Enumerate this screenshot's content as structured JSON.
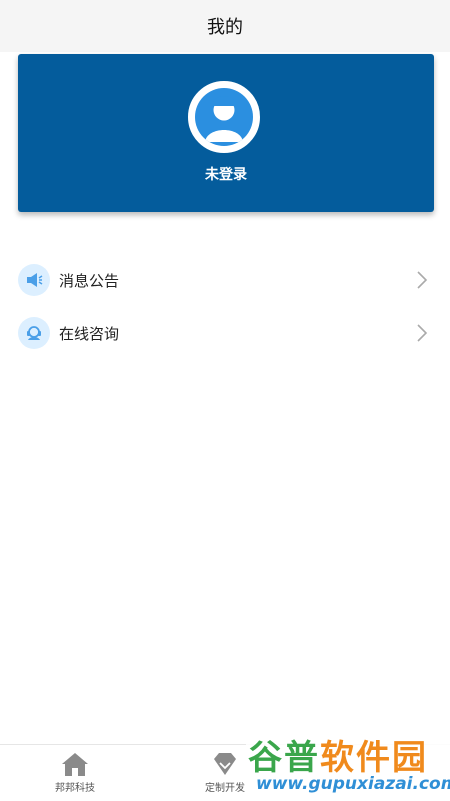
{
  "header": {
    "title": "我的"
  },
  "profile": {
    "login_status": "未登录"
  },
  "menu": [
    {
      "label": "消息公告",
      "icon": "megaphone-icon"
    },
    {
      "label": "在线咨询",
      "icon": "customer-service-icon"
    }
  ],
  "tabbar": [
    {
      "label": "邦邦科技",
      "icon": "home-icon"
    },
    {
      "label": "定制开发",
      "icon": "diamond-icon"
    }
  ],
  "watermark": {
    "brand_green": "谷普",
    "brand_orange": "软件园",
    "url": "www.gupuxiazai.com"
  },
  "colors": {
    "card": "#045c9c",
    "avatar": "#2b8fe0",
    "icon_bg": "#dcefff",
    "icon_fg": "#4a9fe8"
  }
}
